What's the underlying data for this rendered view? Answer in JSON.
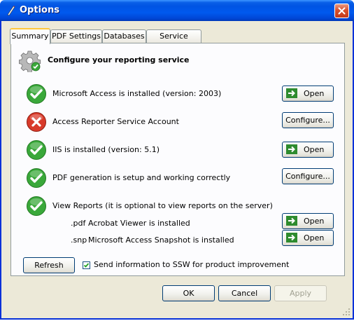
{
  "window": {
    "title": "Options"
  },
  "tabs": [
    {
      "label": "Summary"
    },
    {
      "label": "PDF Settings"
    },
    {
      "label": "Databases"
    },
    {
      "label": "Service Logon"
    }
  ],
  "summary": {
    "heading": "Configure your reporting service",
    "items": [
      {
        "status": "ok",
        "label": "Microsoft Access is installed (version: 2003)",
        "button": "Open"
      },
      {
        "status": "error",
        "label": "Access Reporter Service Account",
        "button": "Configure..."
      },
      {
        "status": "ok",
        "label": "IIS is installed (version: 5.1)",
        "button": "Open"
      },
      {
        "status": "ok",
        "label": "PDF generation is setup and working correctly",
        "button": "Configure..."
      },
      {
        "status": "ok",
        "label": "View Reports (it is optional to view reports on the server)"
      }
    ],
    "viewers": [
      {
        "ext": ".pdf",
        "label": "Acrobat Viewer is installed",
        "button": "Open"
      },
      {
        "ext": ".snp",
        "label": "Microsoft Access Snapshot is installed",
        "button": "Open"
      }
    ],
    "refresh_label": "Refresh",
    "improvement_checkbox": {
      "label": "Send information to SSW for product improvement",
      "checked": true
    }
  },
  "footer": {
    "ok_label": "OK",
    "cancel_label": "Cancel",
    "apply_label": "Apply"
  },
  "colors": {
    "ok_green": "#3aa83a",
    "error_red": "#d83a2a",
    "titlebar_blue": "#0054e3",
    "tab_highlight": "#ffc83c"
  }
}
